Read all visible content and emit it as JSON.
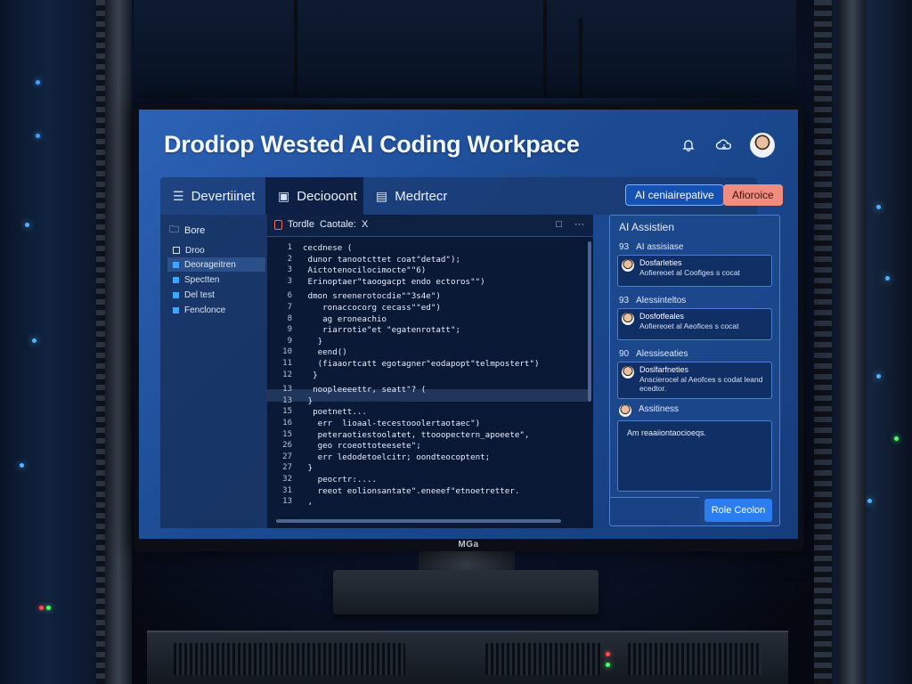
{
  "app": {
    "title": "Drodiop Wested AI Coding Workpace",
    "monitor_brand": "MGa"
  },
  "header_icons": [
    "bell-icon",
    "cloud-icon",
    "user-avatar"
  ],
  "tabs": [
    {
      "label": "Devertiinet",
      "icon": "list-icon"
    },
    {
      "label": "Deciooont",
      "icon": "terminal-icon"
    },
    {
      "label": "Medrtecr",
      "icon": "document-icon"
    }
  ],
  "buttons": {
    "ai_cta": "AI ceniairepative",
    "alt_cta": "Afioroice"
  },
  "sidebar": {
    "header": "Bore",
    "items": [
      {
        "label": "Droo",
        "active": false
      },
      {
        "label": "Deorageitren",
        "active": true
      },
      {
        "label": "Spectten",
        "active": false
      },
      {
        "label": "Del test",
        "active": false
      },
      {
        "label": "Fenclonce",
        "active": false
      }
    ]
  },
  "editor": {
    "tab_label": "Tordle",
    "tab_label_2": "Caotale:",
    "close": "X",
    "tools": [
      "□",
      "···"
    ],
    "lines": [
      {
        "n": "1",
        "code": "cecdnese ("
      },
      {
        "n": "2",
        "code": " dunor tanootcttet coat\"detad\");"
      },
      {
        "n": "3",
        "code": " Aictotenocilocimocte\"\"6)"
      },
      {
        "n": "3",
        "code": " Erinoptaer\"taoogacpt endo ectoros\"\")"
      },
      {
        "n": "6",
        "code": " dmon sreenerotocdie\"\"3s4e\")"
      },
      {
        "n": "7",
        "code": "    ronaccocorg cecass\"\"ed\")"
      },
      {
        "n": "8",
        "code": "    ag eroneachio"
      },
      {
        "n": "9",
        "code": "    riarrotie\"et \"egatenrotatt\";"
      },
      {
        "n": "9",
        "code": "   }"
      },
      {
        "n": "10",
        "code": "   eend()"
      },
      {
        "n": "11",
        "code": "   (fiaaortcatt egotagner\"eodapopt\"telmpostert\")"
      },
      {
        "n": "12",
        "code": "  }"
      },
      {
        "n": "13",
        "code": "  noopleeeettr, seatt\"? ("
      },
      {
        "n": "13",
        "code": " }"
      },
      {
        "n": "15",
        "code": "  poetnett..."
      },
      {
        "n": "16",
        "code": "   err  lioaal-tecestooolertaotaec\")"
      },
      {
        "n": "15",
        "code": "   peteraotiestoolatet, ttooopectern_apoeete\","
      },
      {
        "n": "26",
        "code": "   geo rcoeottoteesete\";"
      },
      {
        "n": "27",
        "code": "   err ledodetoelcitr; oondteocoptent;"
      },
      {
        "n": "27",
        "code": " }"
      },
      {
        "n": "32",
        "code": "   peocrtr:...."
      },
      {
        "n": "31",
        "code": "   reeot eolionsantate\".eneeef\"etnoetretter."
      },
      {
        "n": "13",
        "code": " ,"
      }
    ]
  },
  "assistant": {
    "title": "AI Assistien",
    "sections": [
      {
        "num": "93",
        "label": "AI assisiase",
        "card_title": "Dosfarleties",
        "card_text": "Aofiereoet al Coofiges s cocat"
      },
      {
        "num": "93",
        "label": "Alessinteltos",
        "card_title": "Dosfotfeales",
        "card_text": "Aofiereoet al Aeofices s cocat"
      },
      {
        "num": "90",
        "label": "Alessiseaties",
        "card_title": "Doslfarfneties",
        "card_text": "Anscierocel al Aeofces s codat leand ecedtor."
      }
    ],
    "chat": {
      "title": "Assitiness",
      "text": "Am reaaiiontaocioeqs."
    },
    "send_label": "Role Ceolon"
  },
  "colors": {
    "screen_bg": "#1c4a92",
    "accent": "#2c7df0",
    "alert": "#f08d80"
  }
}
